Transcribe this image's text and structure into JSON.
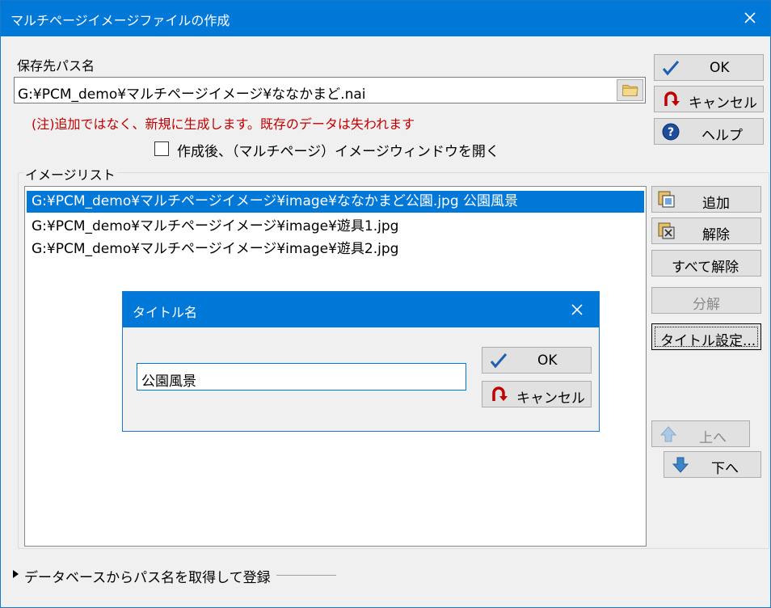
{
  "window": {
    "title": "マルチページイメージファイルの作成"
  },
  "save_path": {
    "label": "保存先パス名",
    "value": "G:¥PCM_demo¥マルチページイメージ¥ななかまど.nai",
    "warning": "(注)追加ではなく、新規に生成します。既存のデータは失われます"
  },
  "open_after": {
    "label": "作成後、（マルチページ）イメージウィンドウを開く",
    "checked": false
  },
  "buttons": {
    "ok": "OK",
    "cancel": "キャンセル",
    "help": "ヘルプ"
  },
  "image_list": {
    "label": "イメージリスト",
    "items": [
      {
        "path": "G:¥PCM_demo¥マルチページイメージ¥image¥ななかまど公園.jpg  公園風景",
        "selected": true
      },
      {
        "path": "G:¥PCM_demo¥マルチページイメージ¥image¥遊具1.jpg",
        "selected": false
      },
      {
        "path": "G:¥PCM_demo¥マルチページイメージ¥image¥遊具2.jpg",
        "selected": false
      }
    ]
  },
  "list_buttons": {
    "add": "追加",
    "remove": "解除",
    "remove_all": "すべて解除",
    "split": "分解",
    "set_title": "タイトル設定...",
    "up": "上へ",
    "down": "下へ"
  },
  "title_dialog": {
    "title": "タイトル名",
    "value": "公園風景",
    "ok": "OK",
    "cancel": "キャンセル"
  },
  "expander": {
    "label": "データベースからパス名を取得して登録"
  },
  "colors": {
    "accent": "#0078d7",
    "warning": "#c00000",
    "button_face": "#e1e1e1"
  }
}
